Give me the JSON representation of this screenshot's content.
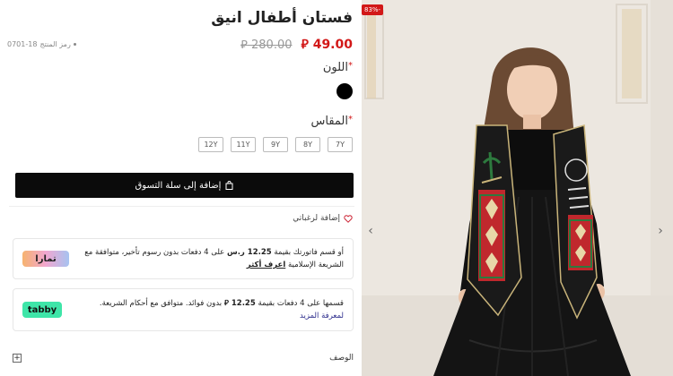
{
  "product": {
    "title": "فستان أطفال انيق",
    "price_new": "49.00",
    "price_old": "280.00",
    "currency_symbol": "⃁",
    "sku_label": "رمز المنتج",
    "sku_value": "0701-18"
  },
  "options": {
    "color_label": "اللون",
    "size_label": "المقاس",
    "required_mark": "*",
    "selected_color": "#000000",
    "sizes": [
      "7Y",
      "8Y",
      "9Y",
      "11Y",
      "12Y"
    ]
  },
  "actions": {
    "add_to_cart": "إضافة إلى سلة التسوق",
    "wishlist": "إضافة لرغباتي"
  },
  "tamara": {
    "logo": "تمارا",
    "text_before": "أو قسم فاتورتك بقيمة",
    "amount": "12.25 ر.س",
    "text_after": "على 4 دفعات بدون رسوم تأخير، متوافقة مع الشريعة الإسلامية",
    "link": "اعرف أكثر"
  },
  "tabby": {
    "logo": "tabby",
    "text_before": "قسمها على 4 دفعات بقيمة",
    "amount": "12.25 ⃁",
    "text_after": "بدون فوائد. متوافق مع أحكام الشريعة.",
    "link": "لمعرفة المزيد"
  },
  "description": {
    "label": "الوصف",
    "toggle": "+"
  },
  "gallery": {
    "discount_badge": "83%-",
    "prev_arrow": "‹",
    "next_arrow": "›",
    "colors": {
      "background": "#ece7e0",
      "dress": "#0d0d0d",
      "sash": "#1a1a1a",
      "red": "#c0282d",
      "green": "#2d7a3e",
      "gold": "#c9b47a"
    }
  },
  "colors": {
    "accent_red": "#d21818",
    "button_dark": "#0b0b0b",
    "tabby_green": "#3ee5a8"
  }
}
